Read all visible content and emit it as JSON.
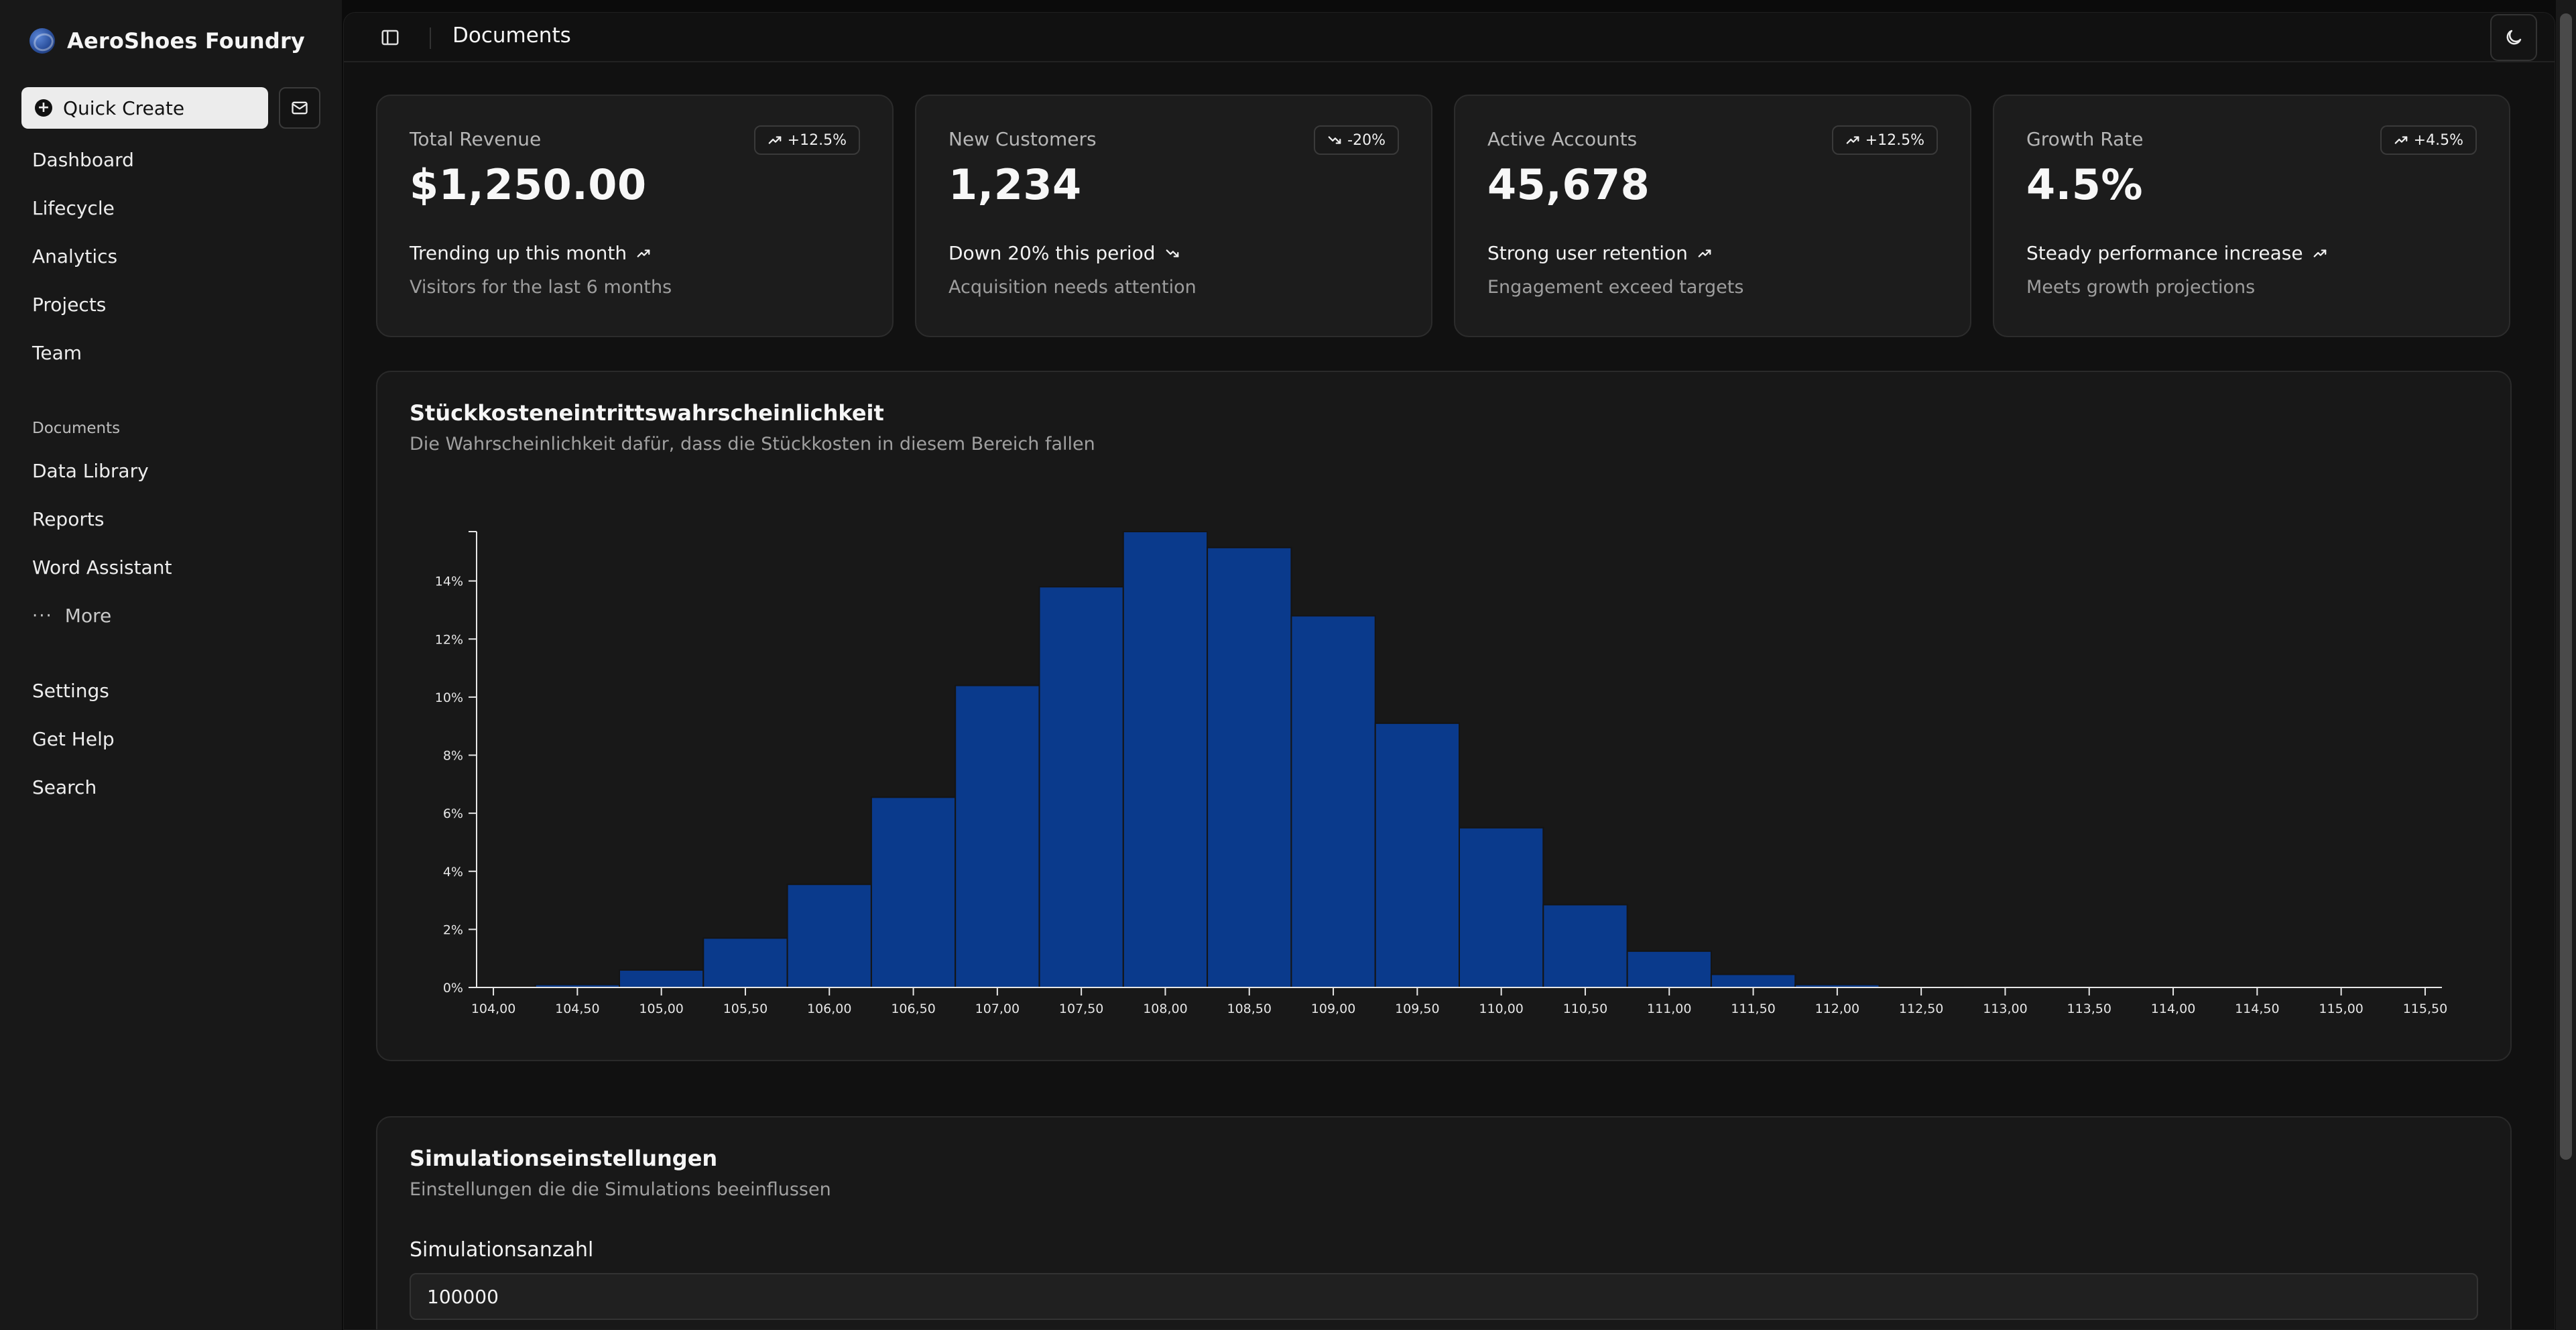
{
  "sidebar": {
    "brand": "AeroShoes Foundry",
    "quick_create": "Quick Create",
    "nav": [
      {
        "label": "Dashboard"
      },
      {
        "label": "Lifecycle"
      },
      {
        "label": "Analytics"
      },
      {
        "label": "Projects"
      },
      {
        "label": "Team"
      }
    ],
    "documents_heading": "Documents",
    "documents": [
      {
        "label": "Data Library"
      },
      {
        "label": "Reports"
      },
      {
        "label": "Word Assistant"
      }
    ],
    "more": "More",
    "footer": [
      {
        "label": "Settings"
      },
      {
        "label": "Get Help"
      },
      {
        "label": "Search"
      }
    ]
  },
  "header": {
    "title": "Documents"
  },
  "cards": [
    {
      "label": "Total Revenue",
      "value": "$1,250.00",
      "badge": "+12.5%",
      "badge_dir": "up",
      "trend": "Trending up this month",
      "trend_dir": "up",
      "sub": "Visitors for the last 6 months"
    },
    {
      "label": "New Customers",
      "value": "1,234",
      "badge": "-20%",
      "badge_dir": "down",
      "trend": "Down 20% this period",
      "trend_dir": "down",
      "sub": "Acquisition needs attention"
    },
    {
      "label": "Active Accounts",
      "value": "45,678",
      "badge": "+12.5%",
      "badge_dir": "up",
      "trend": "Strong user retention",
      "trend_dir": "up",
      "sub": "Engagement exceed targets"
    },
    {
      "label": "Growth Rate",
      "value": "4.5%",
      "badge": "+4.5%",
      "badge_dir": "up",
      "trend": "Steady performance increase",
      "trend_dir": "up",
      "sub": "Meets growth projections"
    }
  ],
  "chart": {
    "title": "Stückkosteneintrittswahrscheinlichkeit",
    "subtitle": "Die Wahrscheinlichkeit dafür, dass die Stückkosten in diesem Bereich fallen"
  },
  "chart_data": {
    "type": "bar",
    "bar_color": "#0a3a8c",
    "bins": [
      {
        "start": 104.25,
        "end": 104.75,
        "value": 0.1
      },
      {
        "start": 104.75,
        "end": 105.25,
        "value": 0.6
      },
      {
        "start": 105.25,
        "end": 105.75,
        "value": 1.7
      },
      {
        "start": 105.75,
        "end": 106.25,
        "value": 3.55
      },
      {
        "start": 106.25,
        "end": 106.75,
        "value": 6.55
      },
      {
        "start": 106.75,
        "end": 107.25,
        "value": 10.4
      },
      {
        "start": 107.25,
        "end": 107.75,
        "value": 13.8
      },
      {
        "start": 107.75,
        "end": 108.25,
        "value": 15.7
      },
      {
        "start": 108.25,
        "end": 108.75,
        "value": 15.15
      },
      {
        "start": 108.75,
        "end": 109.25,
        "value": 12.8
      },
      {
        "start": 109.25,
        "end": 109.75,
        "value": 9.1
      },
      {
        "start": 109.75,
        "end": 110.25,
        "value": 5.5
      },
      {
        "start": 110.25,
        "end": 110.75,
        "value": 2.85
      },
      {
        "start": 110.75,
        "end": 111.25,
        "value": 1.25
      },
      {
        "start": 111.25,
        "end": 111.75,
        "value": 0.45
      },
      {
        "start": 111.75,
        "end": 112.25,
        "value": 0.1
      },
      {
        "start": 112.25,
        "end": 112.75,
        "value": 0.02
      }
    ],
    "x_ticks": [
      "104,00",
      "104,50",
      "105,00",
      "105,50",
      "106,00",
      "106,50",
      "107,00",
      "107,50",
      "108,00",
      "108,50",
      "109,00",
      "109,50",
      "110,00",
      "110,50",
      "111,00",
      "111,50",
      "112,00",
      "112,50",
      "113,00",
      "113,50",
      "114,00",
      "114,50",
      "115,00",
      "115,50"
    ],
    "y_ticks": [
      "0%",
      "2%",
      "4%",
      "6%",
      "8%",
      "10%",
      "12%",
      "14%"
    ],
    "y_tick_values": [
      0,
      2,
      4,
      6,
      8,
      10,
      12,
      14
    ],
    "xlim": [
      103.9,
      115.6
    ],
    "ylim": [
      0,
      15.7
    ]
  },
  "settings": {
    "title": "Simulationseinstellungen",
    "subtitle": "Einstellungen die die Simulations beeinflussen",
    "field_label": "Simulationsanzahl",
    "field_value": "100000"
  }
}
